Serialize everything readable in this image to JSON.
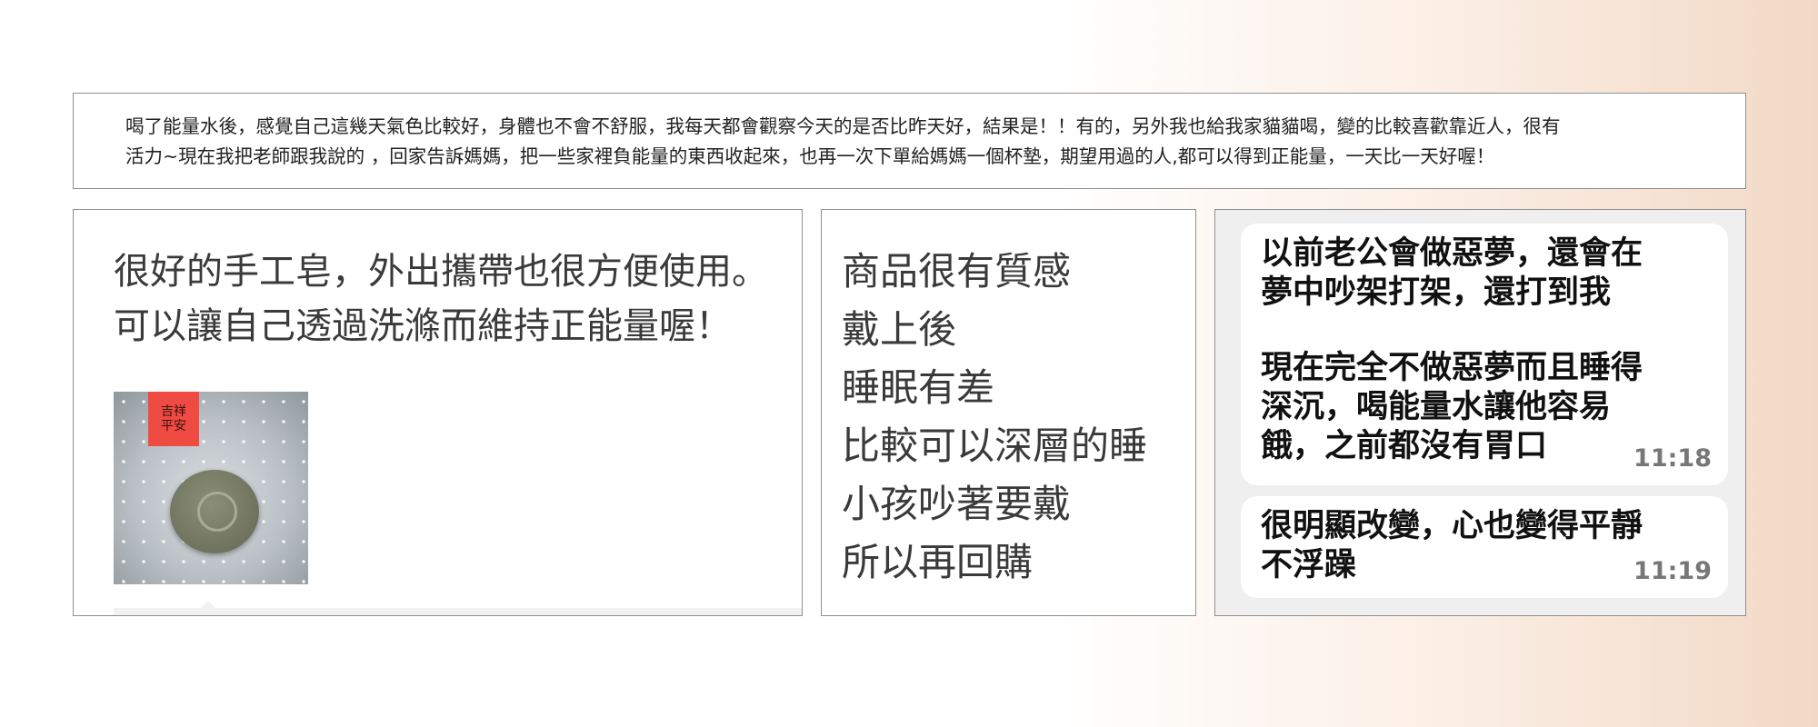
{
  "top_review": {
    "line1": "喝了能量水後，感覺自己這幾天氣色比較好，身體也不會不舒服，我每天都會觀察今天的是否比昨天好，結果是！！有的，另外我也給我家貓貓喝，變的比較喜歡靠近人，很有",
    "line2": "活力~現在我把老師跟我說的 ，回家告訴媽媽，把一些家裡負能量的東西收起來，也再一次下單給媽媽一個杯墊，期望用過的人,都可以得到正能量，一天比一天好喔！"
  },
  "soap_review": {
    "line1": "很好的手工皂，外出攜帶也很方便使用。",
    "line2": "可以讓自己透過洗滌而維持正能量喔！",
    "photo_tag": "平安",
    "photo_tag_2": "吉祥"
  },
  "quality_review": {
    "lines": [
      "商品很有質感",
      "戴上後",
      "睡眠有差",
      "比較可以深層的睡",
      "小孩吵著要戴",
      "所以再回購"
    ]
  },
  "chat_review": {
    "message1": {
      "line1": "以前老公會做惡夢，還會在",
      "line2": "夢中吵架打架，還打到我",
      "line3": "現在完全不做惡夢而且睡得",
      "line4": "深沉，喝能量水讓他容易",
      "line5": "餓，之前都沒有胃口",
      "time": "11:18"
    },
    "message2": {
      "line1": "很明顯改變，心也變得平靜",
      "line2": "不浮躁",
      "time": "11:19"
    }
  }
}
